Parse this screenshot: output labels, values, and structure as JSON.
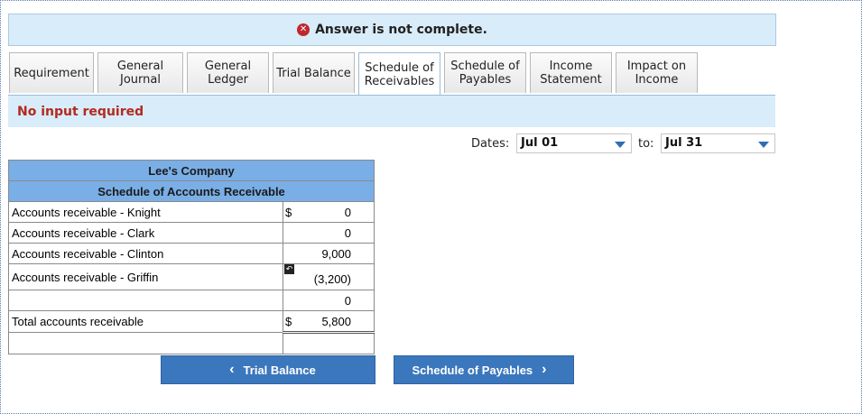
{
  "banner": {
    "icon": "close-circle-icon",
    "text": "Answer is not complete."
  },
  "tabs": [
    {
      "label": "Requirement"
    },
    {
      "label": "General\nJournal"
    },
    {
      "label": "General\nLedger"
    },
    {
      "label": "Trial Balance"
    },
    {
      "label": "Schedule of\nReceivables",
      "active": true
    },
    {
      "label": "Schedule of\nPayables"
    },
    {
      "label": "Income\nStatement"
    },
    {
      "label": "Impact on\nIncome"
    }
  ],
  "notice": "No input required",
  "dates": {
    "label": "Dates:",
    "from": "Jul 01",
    "to_label": "to:",
    "to": "Jul 31"
  },
  "schedule": {
    "company": "Lee's Company",
    "title": "Schedule of Accounts Receivable",
    "rows": [
      {
        "label": "Accounts receivable - Knight",
        "dollar": "$",
        "amount": "0"
      },
      {
        "label": "Accounts receivable - Clark",
        "dollar": "",
        "amount": "0"
      },
      {
        "label": "Accounts receivable - Clinton",
        "dollar": "",
        "amount": "9,000"
      },
      {
        "label": "Accounts receivable - Griffin",
        "dollar": "",
        "amount": "(3,200)"
      },
      {
        "label": "",
        "dollar": "",
        "amount": "0"
      }
    ],
    "total": {
      "label": "Total accounts receivable",
      "dollar": "$",
      "amount": "5,800"
    }
  },
  "nav": {
    "prev": "Trial Balance",
    "next": "Schedule of Payables"
  },
  "colors": {
    "accent": "#3b77bd",
    "header": "#7aaee6",
    "banner": "#d9ecf9",
    "error": "#b22a1e"
  }
}
